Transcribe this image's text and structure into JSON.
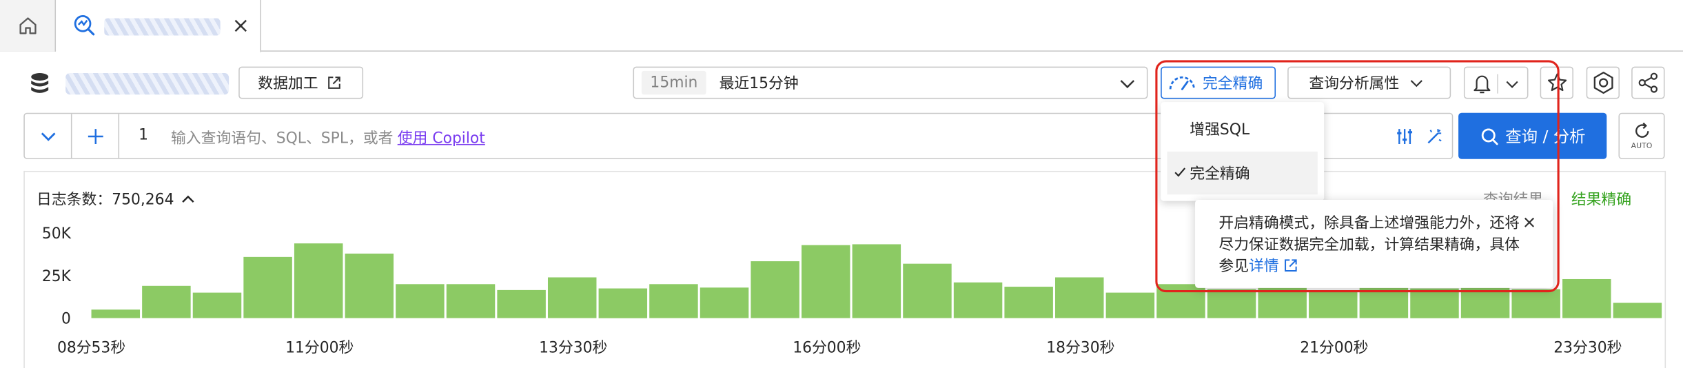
{
  "tabs": {
    "home_icon": "home-icon",
    "active_tab_icon": "query-analysis-icon",
    "close_icon": "close-icon"
  },
  "toolbar": {
    "data_process_label": "数据加工",
    "time_badge": "15min",
    "time_label": "最近15分钟",
    "precise_label": "完全精确",
    "props_label": "查询分析属性"
  },
  "query": {
    "line_number": "1",
    "placeholder": "输入查询语句、SQL、SPL，或者",
    "copilot_link": "使用 Copilot",
    "search_label": "查询 / 分析",
    "auto_label": "AUTO"
  },
  "summary": {
    "log_count_label": "日志条数：750,264",
    "result_label": "查询结果",
    "result_value": "结果精确"
  },
  "dropdown": {
    "options": [
      "增强SQL",
      "完全精确"
    ],
    "selected": "完全精确"
  },
  "tooltip": {
    "text": "开启精确模式，除具备上述增强能力外，还将尽力保证数据完全加载，计算结果精确，具体参见",
    "link": "详情"
  },
  "colors": {
    "accent": "#1f6fe0",
    "bar": "#8cca64",
    "highlight": "#e0241c",
    "result_ok": "#36a320"
  },
  "chart_data": {
    "type": "bar",
    "yticks": [
      "50K",
      "25K",
      "0"
    ],
    "ytick_values": [
      50000,
      25000,
      0
    ],
    "ylim": [
      0,
      50000
    ],
    "xticks": [
      "08分53秒",
      "11分00秒",
      "13分30秒",
      "16分00秒",
      "18分30秒",
      "21分00秒",
      "23分30秒"
    ],
    "xtick_positions": [
      0,
      4.5,
      9.5,
      14.5,
      19.5,
      24.5,
      29.5
    ],
    "values": [
      5000,
      19000,
      15000,
      36000,
      44000,
      38000,
      20000,
      20000,
      16500,
      24000,
      17500,
      20000,
      18000,
      33500,
      43000,
      43500,
      32000,
      21000,
      18500,
      24000,
      15000,
      20000,
      17000,
      18000,
      16000,
      19000,
      17500,
      20000,
      17000,
      23000,
      9000
    ]
  }
}
